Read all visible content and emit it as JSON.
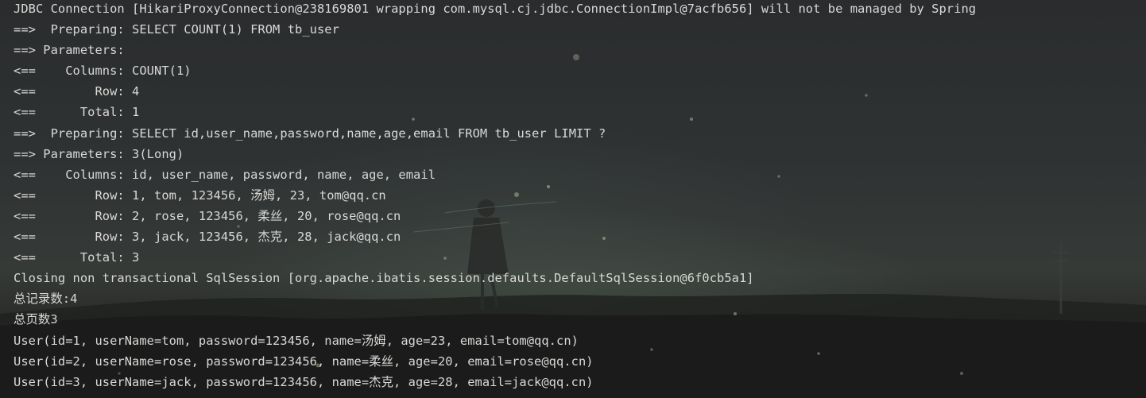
{
  "console": {
    "lines": [
      "JDBC Connection [HikariProxyConnection@238169801 wrapping com.mysql.cj.jdbc.ConnectionImpl@7acfb656] will not be managed by Spring",
      "==>  Preparing: SELECT COUNT(1) FROM tb_user",
      "==> Parameters: ",
      "<==    Columns: COUNT(1)",
      "<==        Row: 4",
      "<==      Total: 1",
      "==>  Preparing: SELECT id,user_name,password,name,age,email FROM tb_user LIMIT ?",
      "==> Parameters: 3(Long)",
      "<==    Columns: id, user_name, password, name, age, email",
      "<==        Row: 1, tom, 123456, 汤姆, 23, tom@qq.cn",
      "<==        Row: 2, rose, 123456, 柔丝, 20, rose@qq.cn",
      "<==        Row: 3, jack, 123456, 杰克, 28, jack@qq.cn",
      "<==      Total: 3",
      "Closing non transactional SqlSession [org.apache.ibatis.session.defaults.DefaultSqlSession@6f0cb5a1]",
      "总记录数:4",
      "总页数3",
      "User(id=1, userName=tom, password=123456, name=汤姆, age=23, email=tom@qq.cn)",
      "User(id=2, userName=rose, password=123456, name=柔丝, age=20, email=rose@qq.cn)",
      "User(id=3, userName=jack, password=123456, name=杰克, age=28, email=jack@qq.cn)"
    ]
  },
  "colors": {
    "text": "#d9d9d6",
    "background": "#2b2d2f"
  }
}
